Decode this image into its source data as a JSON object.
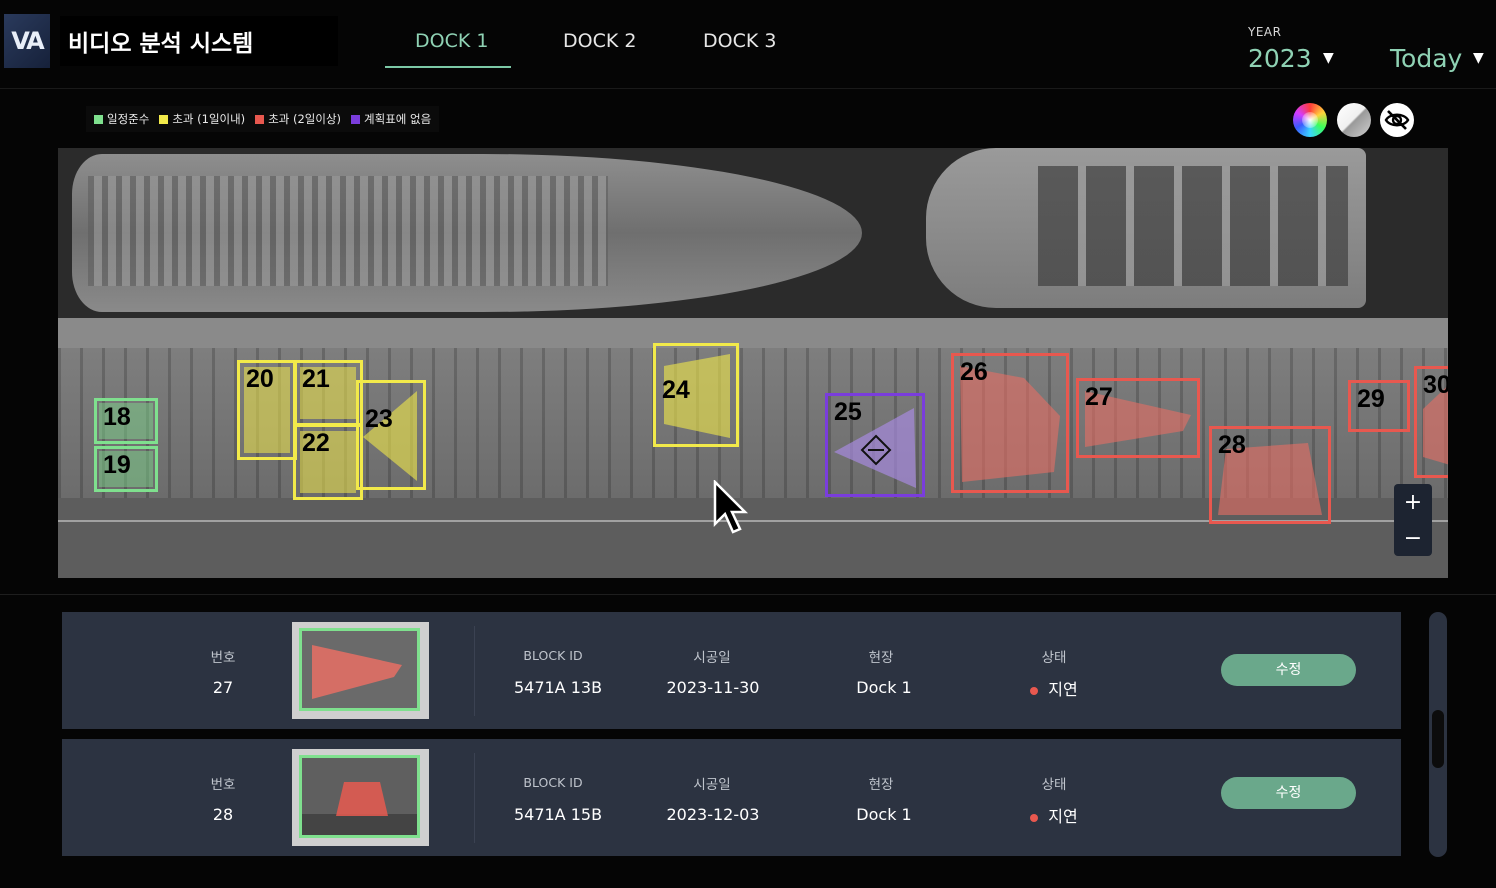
{
  "header": {
    "logo_text": "VA",
    "title": "비디오 분석 시스템",
    "tabs": [
      "DOCK 1",
      "DOCK 2",
      "DOCK 3"
    ],
    "active_tab": "DOCK 1",
    "year_label": "YEAR",
    "year_value": "2023",
    "date_value": "Today"
  },
  "legend": [
    {
      "label": "일정준수",
      "color": "#7fe08e"
    },
    {
      "label": "초과 (1일이내)",
      "color": "#f2ea4a"
    },
    {
      "label": "초과 (2일이상)",
      "color": "#e8584f"
    },
    {
      "label": "계획표에 없음",
      "color": "#7a3ddc"
    }
  ],
  "view_buttons": {
    "color_icon": "color-wheel-icon",
    "gray_icon": "grayscale-icon",
    "hide_icon": "eye-off-icon"
  },
  "map": {
    "blocks": [
      {
        "id": "18",
        "status": "on-schedule"
      },
      {
        "id": "19",
        "status": "on-schedule"
      },
      {
        "id": "20",
        "status": "over-1day"
      },
      {
        "id": "21",
        "status": "over-1day"
      },
      {
        "id": "22",
        "status": "over-1day"
      },
      {
        "id": "23",
        "status": "over-1day"
      },
      {
        "id": "24",
        "status": "over-1day"
      },
      {
        "id": "25",
        "status": "unplanned"
      },
      {
        "id": "26",
        "status": "over-2days"
      },
      {
        "id": "27",
        "status": "over-2days"
      },
      {
        "id": "28",
        "status": "over-2days"
      },
      {
        "id": "29",
        "status": "over-2days"
      },
      {
        "id": "30",
        "status": "over-2days"
      }
    ],
    "zoom_in": "+",
    "zoom_out": "−"
  },
  "list": {
    "headers": {
      "no": "번호",
      "block_id": "BLOCK ID",
      "date": "시공일",
      "site": "현장",
      "status": "상태"
    },
    "edit_label": "수정",
    "rows": [
      {
        "no": "27",
        "block_id": "5471A 13B",
        "date": "2023-11-30",
        "site": "Dock 1",
        "status": "지연"
      },
      {
        "no": "28",
        "block_id": "5471A 15B",
        "date": "2023-12-03",
        "site": "Dock 1",
        "status": "지연"
      }
    ]
  }
}
